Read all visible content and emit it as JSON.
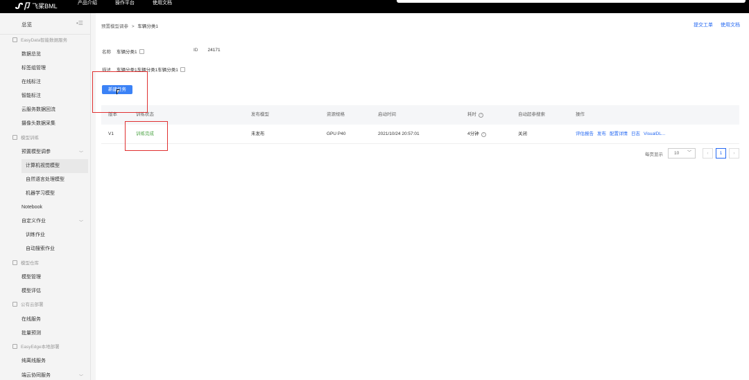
{
  "topbar": {
    "logo_mark": "ᔑ卩",
    "logo_text": "飞桨BML",
    "nav": [
      "产品介绍",
      "操作平台",
      "使用文档"
    ]
  },
  "sidebar": {
    "overview": "总览",
    "collapse_icon": "menu-collapse-icon",
    "groups": [
      {
        "label": "EasyData智能数据服务",
        "icon": "data-service-icon"
      },
      {
        "label": "模型训练",
        "icon": "model-train-icon"
      },
      {
        "label": "模型仓库",
        "icon": "model-repo-icon"
      },
      {
        "label": "公有云部署",
        "icon": "cloud-deploy-icon"
      },
      {
        "label": "EasyEdge本地部署",
        "icon": "edge-deploy-icon"
      }
    ],
    "items": {
      "data_overview": "数据总览",
      "label_group": "标签组管理",
      "online_label": "在线标注",
      "smart_label": "智能标注",
      "cloud_flow": "云服务数据回流",
      "camera_collect": "摄像头数据采集",
      "preset_tuning": "预置模型调参",
      "cv_model": "计算机视觉模型",
      "nlp_model": "自然语言处理模型",
      "ml_model": "机器学习模型",
      "notebook": "Notebook",
      "custom_job": "自定义作业",
      "train_job": "训练作业",
      "auto_search_job": "自动搜索作业",
      "model_manage": "模型管理",
      "model_eval": "模型评估",
      "online_service": "在线服务",
      "batch_predict": "批量预测",
      "offline_service": "纯离线服务",
      "edge_cloud": "端云协同服务"
    }
  },
  "main": {
    "breadcrumb": {
      "parent": "预置模型调参",
      "separator": ">",
      "current": "车辆分类1"
    },
    "links": {
      "ticket": "提交工单",
      "docs": "使用文档"
    },
    "name_label": "名称",
    "name_value": "车辆分类1",
    "id_label": "ID",
    "id_value": "24171",
    "desc_label": "描述",
    "desc_value": "车辆分类1车辆分类1车辆分类1",
    "create_button": "新建任务",
    "table": {
      "headers": [
        "版本",
        "训练状态",
        "发布模型",
        "资源规格",
        "启动时间",
        "耗时",
        "自动超参搜索",
        "操作"
      ],
      "rows": [
        {
          "version": "V1",
          "status": "训练完成",
          "published": "未发布",
          "resource": "GPU P40",
          "start_time": "2021/10/24 20:57:01",
          "duration": "4分钟",
          "auto_search": "关闭",
          "ops": [
            "评估报告",
            "发布",
            "配置详情",
            "日志",
            "VisualDL..."
          ]
        }
      ]
    },
    "pager": {
      "per_page_label": "每页显示",
      "per_page_value": "10",
      "current_page": "1"
    },
    "colors": {
      "accent": "#2468f2",
      "success": "#52a64a",
      "annotation": "#e03030"
    }
  }
}
